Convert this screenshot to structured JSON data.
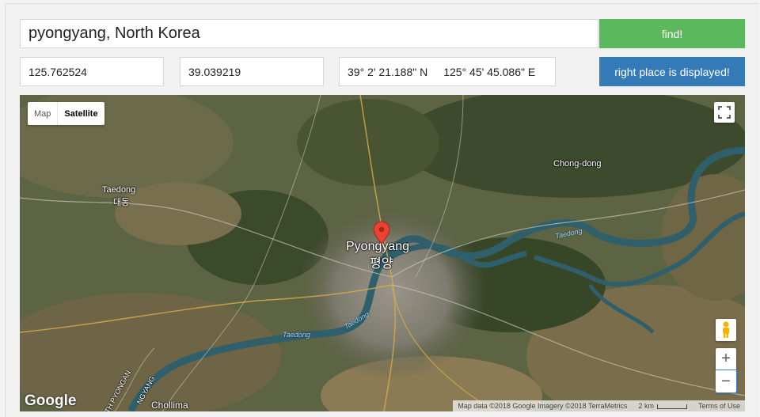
{
  "search": {
    "value": "pyongyang, North Korea"
  },
  "buttons": {
    "find": "find!",
    "confirm": "right place is displayed!"
  },
  "coords": {
    "longitude": "125.762524",
    "latitude": "39.039219",
    "dms_lat": "39° 2' 21.188\" N",
    "dms_lng": "125° 45' 45.086\" E"
  },
  "map": {
    "type_options": {
      "map": "Map",
      "satellite": "Satellite"
    },
    "selected_type": "Satellite",
    "labels": {
      "city": "Pyongyang",
      "city_korean": "평양",
      "taedong_town": "Taedong",
      "taedong_town_korean": "대동",
      "chong_dong": "Chong-dong",
      "chollima": "Chollima",
      "river_east": "Taedong",
      "river_west": "Taedong",
      "river_center": "Taedong",
      "road_left": "TH PYONGAN",
      "road_left2": "NGYANG"
    },
    "zoom": {
      "in": "+",
      "out": "−"
    },
    "attribution": {
      "data": "Map data ©2018 Google Imagery ©2018 TerraMetrics",
      "scale": "2 km",
      "terms": "Terms of Use"
    },
    "logo": "Google",
    "colors": {
      "pin": "#ea4335",
      "river": "#2f5f6a"
    }
  }
}
